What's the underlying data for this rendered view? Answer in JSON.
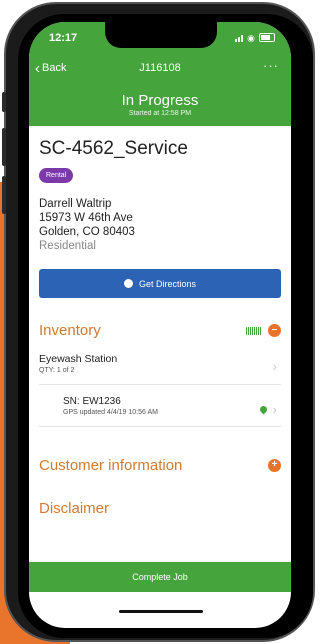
{
  "status_bar": {
    "time": "12:17"
  },
  "nav": {
    "back_label": "Back",
    "title": "J116108",
    "more_label": "···"
  },
  "banner": {
    "status": "In Progress",
    "started": "Started at 12:58 PM"
  },
  "job": {
    "id": "SC-4562_Service",
    "tag": "Rental",
    "customer_name": "Darrell Waltrip",
    "address_line1": "15973 W 46th Ave",
    "address_line2": "Golden, CO 80403",
    "customer_type": "Residential"
  },
  "directions": {
    "label": "Get Directions"
  },
  "inventory": {
    "title": "Inventory",
    "item": {
      "name": "Eyewash Station",
      "qty": "QTY: 1 of 2"
    },
    "serial": {
      "sn": "SN: EW1236",
      "gps": "GPS updated 4/4/19 10:56 AM"
    }
  },
  "customer_info": {
    "title": "Customer information"
  },
  "disclaimer": {
    "title": "Disclaimer"
  },
  "footer": {
    "complete_label": "Complete Job"
  },
  "colors": {
    "green": "#46a43d",
    "blue": "#2d63b5",
    "orange": "#e8742b",
    "purple": "#7b3aa7",
    "section_text": "#d27a2e"
  }
}
